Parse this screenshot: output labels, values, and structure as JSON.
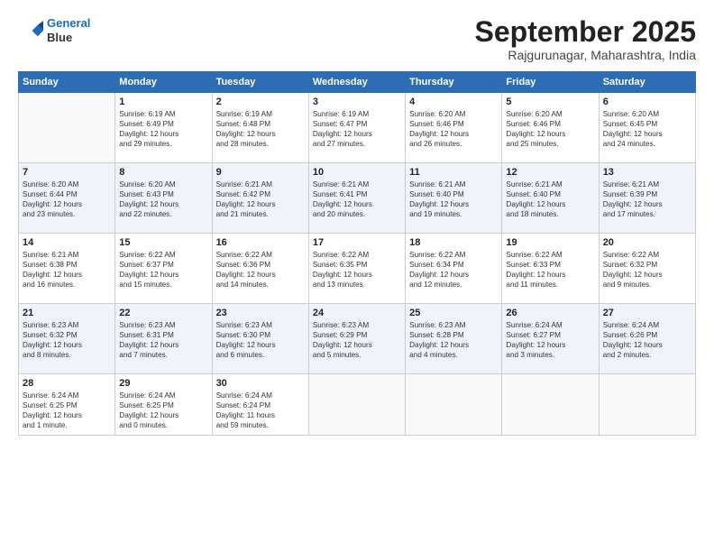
{
  "header": {
    "logo_line1": "General",
    "logo_line2": "Blue",
    "month": "September 2025",
    "location": "Rajgurunagar, Maharashtra, India"
  },
  "days_of_week": [
    "Sunday",
    "Monday",
    "Tuesday",
    "Wednesday",
    "Thursday",
    "Friday",
    "Saturday"
  ],
  "weeks": [
    [
      {
        "day": "",
        "info": ""
      },
      {
        "day": "1",
        "info": "Sunrise: 6:19 AM\nSunset: 6:49 PM\nDaylight: 12 hours\nand 29 minutes."
      },
      {
        "day": "2",
        "info": "Sunrise: 6:19 AM\nSunset: 6:48 PM\nDaylight: 12 hours\nand 28 minutes."
      },
      {
        "day": "3",
        "info": "Sunrise: 6:19 AM\nSunset: 6:47 PM\nDaylight: 12 hours\nand 27 minutes."
      },
      {
        "day": "4",
        "info": "Sunrise: 6:20 AM\nSunset: 6:46 PM\nDaylight: 12 hours\nand 26 minutes."
      },
      {
        "day": "5",
        "info": "Sunrise: 6:20 AM\nSunset: 6:46 PM\nDaylight: 12 hours\nand 25 minutes."
      },
      {
        "day": "6",
        "info": "Sunrise: 6:20 AM\nSunset: 6:45 PM\nDaylight: 12 hours\nand 24 minutes."
      }
    ],
    [
      {
        "day": "7",
        "info": "Sunrise: 6:20 AM\nSunset: 6:44 PM\nDaylight: 12 hours\nand 23 minutes."
      },
      {
        "day": "8",
        "info": "Sunrise: 6:20 AM\nSunset: 6:43 PM\nDaylight: 12 hours\nand 22 minutes."
      },
      {
        "day": "9",
        "info": "Sunrise: 6:21 AM\nSunset: 6:42 PM\nDaylight: 12 hours\nand 21 minutes."
      },
      {
        "day": "10",
        "info": "Sunrise: 6:21 AM\nSunset: 6:41 PM\nDaylight: 12 hours\nand 20 minutes."
      },
      {
        "day": "11",
        "info": "Sunrise: 6:21 AM\nSunset: 6:40 PM\nDaylight: 12 hours\nand 19 minutes."
      },
      {
        "day": "12",
        "info": "Sunrise: 6:21 AM\nSunset: 6:40 PM\nDaylight: 12 hours\nand 18 minutes."
      },
      {
        "day": "13",
        "info": "Sunrise: 6:21 AM\nSunset: 6:39 PM\nDaylight: 12 hours\nand 17 minutes."
      }
    ],
    [
      {
        "day": "14",
        "info": "Sunrise: 6:21 AM\nSunset: 6:38 PM\nDaylight: 12 hours\nand 16 minutes."
      },
      {
        "day": "15",
        "info": "Sunrise: 6:22 AM\nSunset: 6:37 PM\nDaylight: 12 hours\nand 15 minutes."
      },
      {
        "day": "16",
        "info": "Sunrise: 6:22 AM\nSunset: 6:36 PM\nDaylight: 12 hours\nand 14 minutes."
      },
      {
        "day": "17",
        "info": "Sunrise: 6:22 AM\nSunset: 6:35 PM\nDaylight: 12 hours\nand 13 minutes."
      },
      {
        "day": "18",
        "info": "Sunrise: 6:22 AM\nSunset: 6:34 PM\nDaylight: 12 hours\nand 12 minutes."
      },
      {
        "day": "19",
        "info": "Sunrise: 6:22 AM\nSunset: 6:33 PM\nDaylight: 12 hours\nand 11 minutes."
      },
      {
        "day": "20",
        "info": "Sunrise: 6:22 AM\nSunset: 6:32 PM\nDaylight: 12 hours\nand 9 minutes."
      }
    ],
    [
      {
        "day": "21",
        "info": "Sunrise: 6:23 AM\nSunset: 6:32 PM\nDaylight: 12 hours\nand 8 minutes."
      },
      {
        "day": "22",
        "info": "Sunrise: 6:23 AM\nSunset: 6:31 PM\nDaylight: 12 hours\nand 7 minutes."
      },
      {
        "day": "23",
        "info": "Sunrise: 6:23 AM\nSunset: 6:30 PM\nDaylight: 12 hours\nand 6 minutes."
      },
      {
        "day": "24",
        "info": "Sunrise: 6:23 AM\nSunset: 6:29 PM\nDaylight: 12 hours\nand 5 minutes."
      },
      {
        "day": "25",
        "info": "Sunrise: 6:23 AM\nSunset: 6:28 PM\nDaylight: 12 hours\nand 4 minutes."
      },
      {
        "day": "26",
        "info": "Sunrise: 6:24 AM\nSunset: 6:27 PM\nDaylight: 12 hours\nand 3 minutes."
      },
      {
        "day": "27",
        "info": "Sunrise: 6:24 AM\nSunset: 6:26 PM\nDaylight: 12 hours\nand 2 minutes."
      }
    ],
    [
      {
        "day": "28",
        "info": "Sunrise: 6:24 AM\nSunset: 6:25 PM\nDaylight: 12 hours\nand 1 minute."
      },
      {
        "day": "29",
        "info": "Sunrise: 6:24 AM\nSunset: 6:25 PM\nDaylight: 12 hours\nand 0 minutes."
      },
      {
        "day": "30",
        "info": "Sunrise: 6:24 AM\nSunset: 6:24 PM\nDaylight: 11 hours\nand 59 minutes."
      },
      {
        "day": "",
        "info": ""
      },
      {
        "day": "",
        "info": ""
      },
      {
        "day": "",
        "info": ""
      },
      {
        "day": "",
        "info": ""
      }
    ]
  ]
}
